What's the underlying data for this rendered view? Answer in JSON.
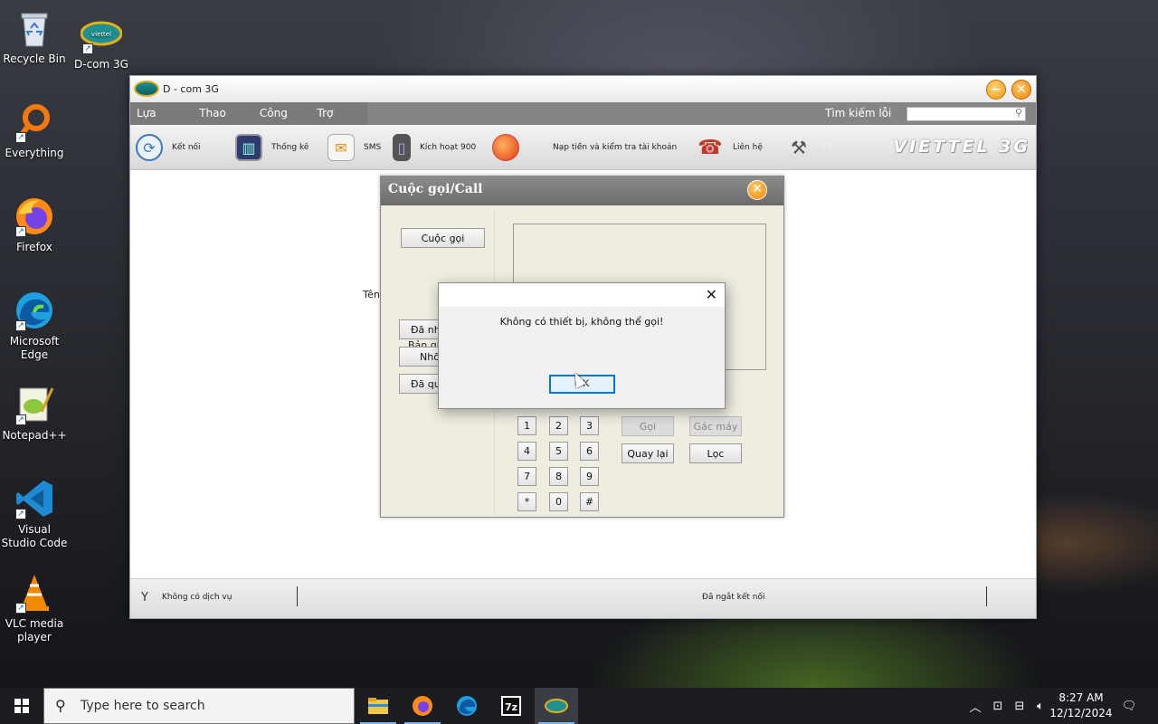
{
  "desktop": {
    "icons": [
      {
        "label": "Recycle Bin"
      },
      {
        "label": "D-com 3G"
      },
      {
        "label": "Everything"
      },
      {
        "label": "Firefox"
      },
      {
        "label": "Microsoft Edge"
      },
      {
        "label": "Notepad++"
      },
      {
        "label": "Visual Studio Code"
      },
      {
        "label": "VLC media player"
      }
    ]
  },
  "window": {
    "title": "D - com 3G",
    "menu": [
      "Lựa chọn",
      "Thao tác",
      "Công cụ",
      "Trợ giúp"
    ],
    "search_label": "Tìm kiếm lỗi",
    "search_value": "",
    "toolbar": [
      "Kết nối",
      "Thống kê",
      "SMS",
      "Kích hoạt 900",
      "Nạp tiền và kiểm tra tài khoản",
      "Liên hệ",
      "Tiện ích"
    ],
    "brand": "VIETTEL 3G",
    "ten_label": "Tên",
    "status_service": "Không có dịch vụ",
    "status_connection": "Đã ngắt kết nối"
  },
  "call_dialog": {
    "title": "Cuộc gọi/Call",
    "cuoc_goi": "Cuộc gọi",
    "ban_ghi": "Bản ghi",
    "da_nhan": "Đã nhận",
    "nho": "Nhỡ",
    "da_quay": "Đã quay",
    "keys": [
      "1",
      "2",
      "3",
      "4",
      "5",
      "6",
      "7",
      "8",
      "9",
      "*",
      "0",
      "#"
    ],
    "goi": "Gọi",
    "gac_may": "Gác máy",
    "quay_lai": "Quay lại",
    "loc": "Lọc"
  },
  "message_box": {
    "text": "Không có thiết bị, không thể gọi!",
    "ok": "OK"
  },
  "taskbar": {
    "search_placeholder": "Type here to search",
    "time": "8:27 AM",
    "date": "12/12/2024"
  },
  "colors": {
    "accent": "#0078d7",
    "menubar": "#858585",
    "dialog_bg": "#efece0",
    "orange": "#f08a00"
  }
}
